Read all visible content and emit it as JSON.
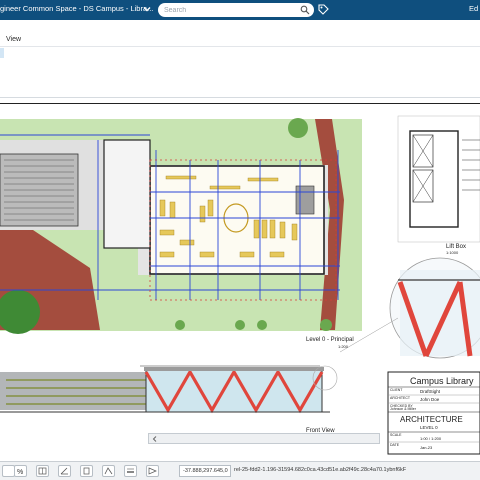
{
  "app": {
    "title": "gineer Common Space - DS Campus - Libra...",
    "user": "Ed"
  },
  "search": {
    "placeholder": "Search"
  },
  "ribbon": {
    "tab_view": "View"
  },
  "drawing": {
    "plan_label": "Level 0 - Principal",
    "plan_scale": "1:200",
    "elevation_label": "Front View",
    "lift_label": "Lift Box",
    "dim_small_1": "1:1000",
    "title_block": {
      "project": "Campus Library",
      "row1_label": "CLIENT",
      "row1_value": "DraftSight",
      "row2_label": "ARCHITECT",
      "row2_value": "John Doe",
      "row3_label": "CHECKED BY",
      "row3_value": "Johnson & Miller",
      "discipline": "ARCHITECTURE",
      "level": "LEVEL 0",
      "scale_label": "SCALE",
      "scale_value": "1:00 / 1:200",
      "date_label": "DATE",
      "date_value": "Jan-23"
    }
  },
  "status": {
    "coords": "-37.888,297.645,0",
    "file_ref": "rel-25-fdd2-1.196-31594.682c0ca.43cd51e.ab2f49c.28c4a70.1ybnf6kF"
  },
  "colors": {
    "topbar": "#0f4f7e",
    "grass": "#c7e3b0",
    "brick": "#a04a3c",
    "blue_line": "#2b46d6",
    "red_truss": "#e0463c"
  }
}
